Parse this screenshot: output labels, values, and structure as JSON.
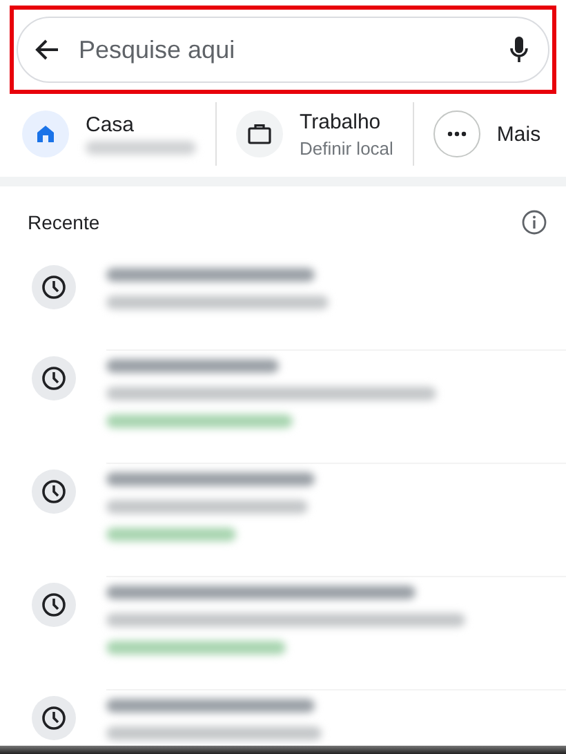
{
  "search": {
    "placeholder": "Pesquise aqui",
    "highlighted": true
  },
  "shortcuts": [
    {
      "kind": "home",
      "label": "Casa",
      "subtitle_redacted": true
    },
    {
      "kind": "work",
      "label": "Trabalho",
      "subtitle": "Definir local"
    },
    {
      "kind": "more",
      "label": "Mais"
    }
  ],
  "recent": {
    "title": "Recente",
    "items": [
      {
        "lines": [
          {
            "kind": "title"
          },
          {
            "kind": "address"
          }
        ]
      },
      {
        "lines": [
          {
            "kind": "title"
          },
          {
            "kind": "address"
          },
          {
            "kind": "status"
          }
        ]
      },
      {
        "lines": [
          {
            "kind": "title"
          },
          {
            "kind": "address"
          },
          {
            "kind": "status"
          }
        ]
      },
      {
        "lines": [
          {
            "kind": "title"
          },
          {
            "kind": "address"
          },
          {
            "kind": "status"
          }
        ]
      },
      {
        "lines": [
          {
            "kind": "title"
          },
          {
            "kind": "address"
          }
        ]
      }
    ]
  }
}
